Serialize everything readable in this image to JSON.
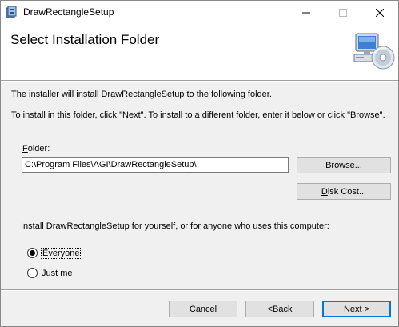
{
  "window": {
    "title": "DrawRectangleSetup",
    "minimize_icon": "minimize-icon",
    "maximize_icon": "maximize-icon",
    "close_icon": "close-icon",
    "app_icon": "installer-package-icon"
  },
  "header": {
    "title": "Select Installation Folder",
    "graphic_icon": "computer-cd-icon"
  },
  "body": {
    "text1": "The installer will install DrawRectangleSetup to the following folder.",
    "text2": "To install in this folder, click \"Next\". To install to a different folder, enter it below or click \"Browse\".",
    "folder_label_accel": "F",
    "folder_label_rest": "older:",
    "folder_value": "C:\\Program Files\\AGI\\DrawRectangleSetup\\",
    "browse_accel": "B",
    "browse_rest": "rowse...",
    "diskcost_accel": "D",
    "diskcost_rest": "isk Cost...",
    "install_for": "Install DrawRectangleSetup for yourself, or for anyone who uses this computer:",
    "radio_everyone_accel": "E",
    "radio_everyone_rest": "veryone",
    "radio_justme_pre": "Just ",
    "radio_justme_accel": "m",
    "radio_justme_rest": "e",
    "selected": "Everyone"
  },
  "footer": {
    "cancel": "Cancel",
    "back_pre": "< ",
    "back_accel": "B",
    "back_rest": "ack",
    "next_accel": "N",
    "next_rest": "ext >"
  },
  "colors": {
    "accent": "#0078d7",
    "window_bg": "#f0f0f0",
    "header_bg": "#ffffff",
    "button_bg": "#e1e1e1"
  }
}
